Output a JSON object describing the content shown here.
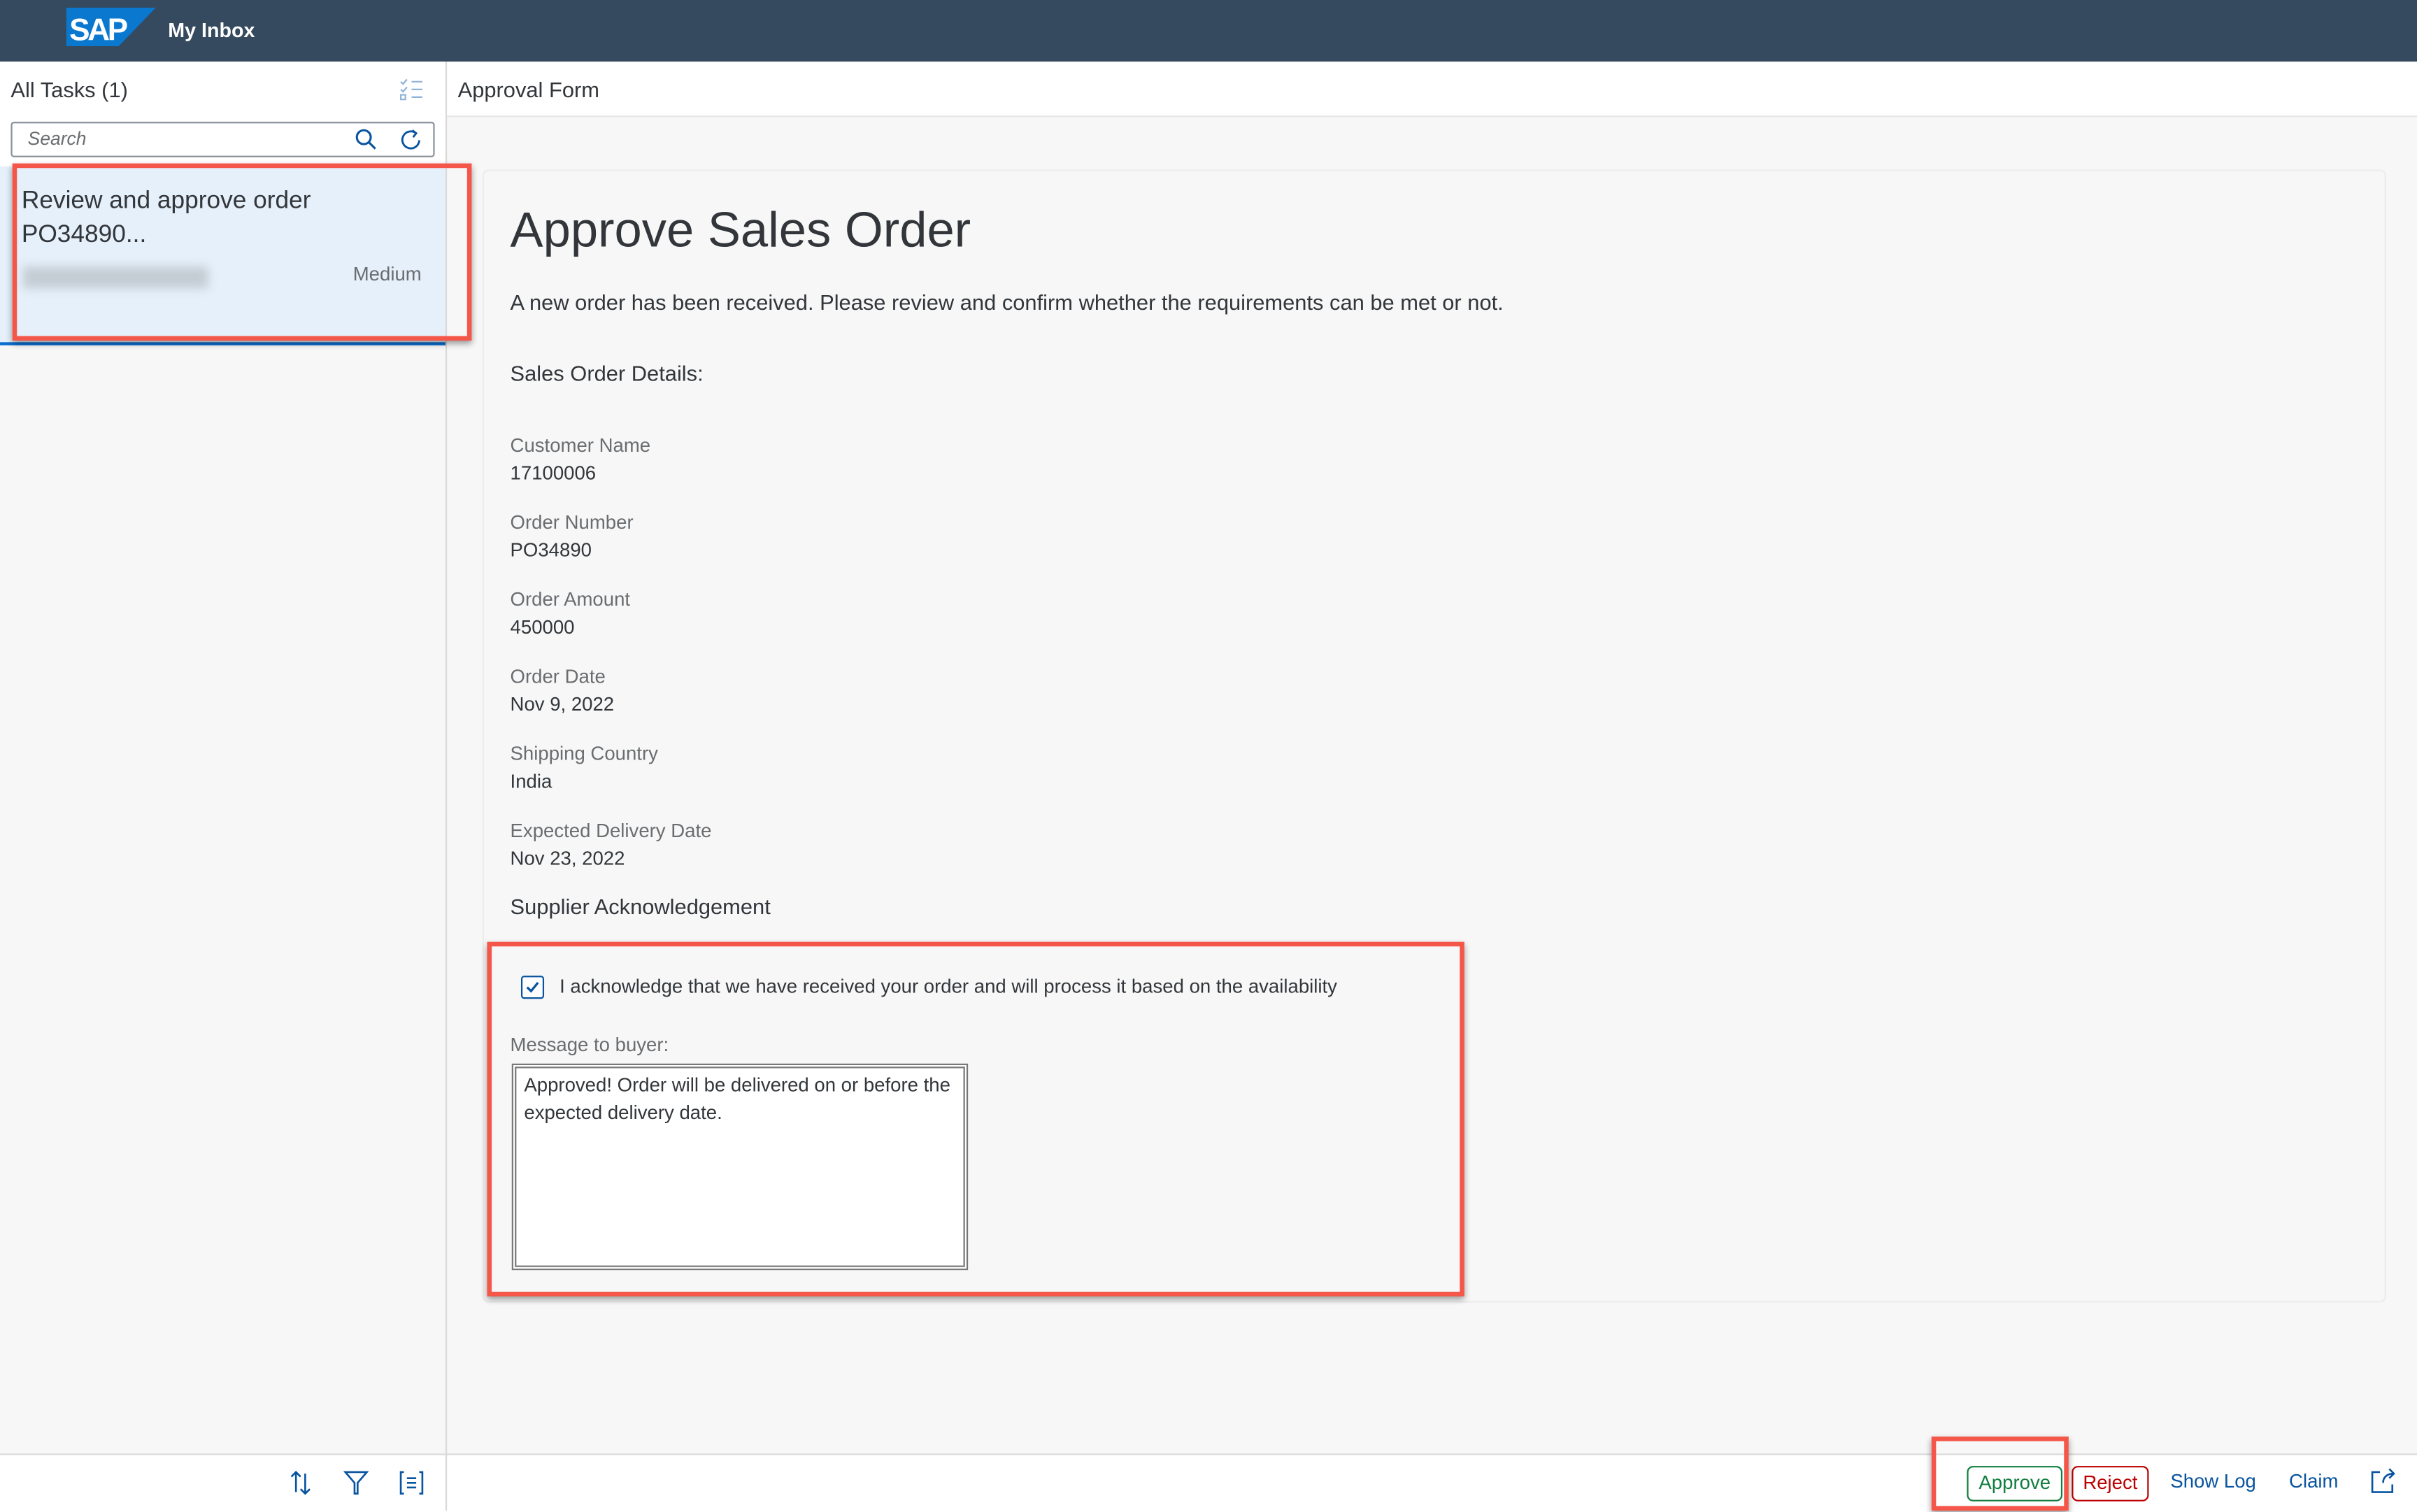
{
  "shell": {
    "logo_text": "SAP",
    "title": "My Inbox"
  },
  "master": {
    "title": "All Tasks (1)",
    "search_placeholder": "Search",
    "tasks": [
      {
        "title": "Review and approve order PO34890...",
        "priority": "Medium"
      }
    ]
  },
  "detail": {
    "header": "Approval Form",
    "heading": "Approve Sales Order",
    "intro": "A new order has been received. Please review and confirm whether the requirements can be met or not.",
    "section_title": "Sales Order Details:",
    "fields": [
      {
        "label": "Customer Name",
        "value": "17100006"
      },
      {
        "label": "Order Number",
        "value": "PO34890"
      },
      {
        "label": "Order Amount",
        "value": "450000"
      },
      {
        "label": "Order Date",
        "value": "Nov 9, 2022"
      },
      {
        "label": "Shipping Country",
        "value": "India"
      },
      {
        "label": "Expected Delivery Date",
        "value": "Nov 23, 2022"
      }
    ],
    "ack_title": "Supplier Acknowledgement",
    "ack_checked": true,
    "ack_text": "I acknowledge that we have received your order and will process it based on the availability",
    "message_label": "Message to buyer:",
    "message_value": "Approved! Order will be delivered on or before the expected delivery date."
  },
  "footer": {
    "approve": "Approve",
    "reject": "Reject",
    "show_log": "Show Log",
    "claim": "Claim"
  },
  "colors": {
    "shell": "#354a5f",
    "approve": "#107e3e",
    "reject": "#bb0000",
    "link": "#0854a0",
    "highlight": "#f4574a"
  }
}
